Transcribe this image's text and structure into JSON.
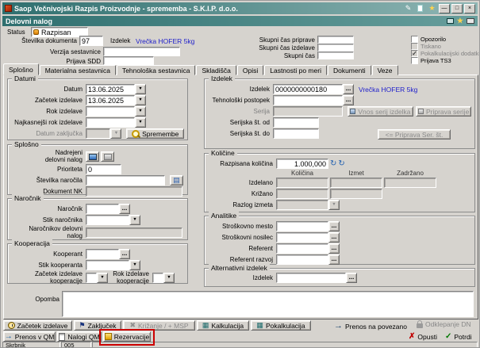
{
  "window": {
    "app_name": "Saop",
    "title": "Večnivojski Razpis Proizvodnje - sprememba  - S.K.I.P.  d.o.o.",
    "caption_bar": "Delovni nalog"
  },
  "icons": {
    "dropdown": "▼",
    "dots": "...",
    "minimize": "—",
    "maximize": "□",
    "close": "×",
    "check": "✓",
    "cross": "✗",
    "arrow_right": "→",
    "star": "★",
    "pencil": "✎",
    "flag": "⚑",
    "refresh": "↻",
    "calculator": "▦",
    "book": "▤",
    "cross_gray": "✖"
  },
  "status_row": {
    "label": "Status",
    "value": "Razpisan"
  },
  "header": {
    "doc_number": {
      "label": "Številka dokumenta",
      "value": "97"
    },
    "product": {
      "label": "Izdelek",
      "value": "Vrečka HOFER 5kg"
    },
    "bom_version_label": "Verzija sestavnice",
    "sdd_label": "Prijava SDD",
    "time_prep_label": "Skupni čas priprave",
    "time_make_label": "Skupni čas izdelave",
    "time_total_label": "Skupni čas",
    "time_prep_value": "",
    "time_make_value": "",
    "time_total_value": "",
    "checkboxes": {
      "opozorilo": "Opozorilo",
      "tiskano": "Tiskano",
      "pokalkulacijski": "Pokalkulacijski dodatki",
      "prijava_ts3": "Prijava TS3"
    }
  },
  "tabs": [
    "Splošno",
    "Materialna sestavnica",
    "Tehnološka sestavnica",
    "Skladišča",
    "Opisi",
    "Lastnosti po meri",
    "Dokumenti",
    "Veze"
  ],
  "datumi": {
    "title": "Datumi",
    "datum": {
      "label": "Datum",
      "value": "13.06.2025"
    },
    "zacetek_izdelave": {
      "label": "Začetek izdelave",
      "value": "13.06.2025"
    },
    "rok_izdelave": {
      "label": "Rok izdelave",
      "value": ""
    },
    "najkasnejsi_rok": {
      "label": "Najkasnejši rok izdelave",
      "value": ""
    },
    "datum_zakljucka": {
      "label": "Datum zaključka",
      "value": ""
    },
    "spremembe_button": "Spremembe"
  },
  "splosno": {
    "title": "Splošno",
    "nadrejeni_line1": "Nadrejeni",
    "nadrejeni_line2": "delovni nalog",
    "prioriteta": {
      "label": "Prioriteta",
      "value": "0"
    },
    "stevilka_narocila": {
      "label": "Številka naročila",
      "value": ""
    },
    "dokument_nk": {
      "label": "Dokument NK",
      "value": ""
    }
  },
  "narocnik": {
    "title": "Naročnik",
    "narocnik": {
      "label": "Naročnik",
      "value": ""
    },
    "stik_narocnika": {
      "label": "Stik naročnika",
      "value": ""
    },
    "narocnikov_dn_line1": "Naročnikov delovni",
    "narocnikov_dn_line2": "nalog",
    "narocnikov_dn_value": ""
  },
  "kooperacija": {
    "title": "Kooperacija",
    "kooperant": {
      "label": "Kooperant",
      "value": ""
    },
    "stik_kooperanta": {
      "label": "Stik kooperanta",
      "value": ""
    },
    "zacetek_line1": "Začetek izdelave",
    "zacetek_line2": "kooperacije",
    "rok_line1": "Rok izdelave",
    "rok_line2": "kooperacije"
  },
  "izdelek_group": {
    "title": "Izdelek",
    "izdelek": {
      "label": "Izdelek",
      "code": "0000000000180",
      "name": "Vrečka HOFER 5kg"
    },
    "tehnoloski_postopek": {
      "label": "Tehnološki postopek",
      "value": ""
    },
    "serija": {
      "label": "Serija",
      "value": ""
    },
    "vnos_serij_button": "Vnos serij izdelka",
    "priprava_serije_button": "Priprava serije",
    "serijska_od": {
      "label": "Serijska št. od",
      "value": ""
    },
    "serijska_do": {
      "label": "Serijska št. do",
      "value": ""
    },
    "priprava_ser_button": "<= Priprava Ser. št."
  },
  "kolicine": {
    "title": "Količine",
    "razpisana": {
      "label": "Razpisana količina",
      "value": "1.000,000"
    },
    "col_kolicina": "Količina",
    "col_izmet": "Izmet",
    "col_zadrzano": "Zadržano",
    "izdelano_label": "Izdelano",
    "krizano_label": "Križano",
    "razlog_izmeta_label": "Razlog izmeta",
    "values": {
      "izdelano": [
        "",
        "",
        ""
      ],
      "krizano": [
        "",
        ""
      ],
      "razlog": ""
    }
  },
  "analitike": {
    "title": "Analitike",
    "stroskovno_mesto": {
      "label": "Stroškovno mesto",
      "value": ""
    },
    "stroskovni_nosilec": {
      "label": "Stroškovni nosilec",
      "value": ""
    },
    "referent": {
      "label": "Referent",
      "value": ""
    },
    "referent_razvoj": {
      "label": "Referent razvoj",
      "value": ""
    }
  },
  "alternativni": {
    "title": "Alternativni izdelek",
    "izdelek": {
      "label": "Izdelek",
      "value": ""
    }
  },
  "opomba": {
    "label": "Opomba",
    "value": ""
  },
  "toolbar": {
    "zacetek_izdelave": "Začetek izdelave",
    "zakljucek": "Zaključek",
    "krizanje_msp": "Križanje / + MSP",
    "kalkulacija": "Kalkulacija",
    "pokalkulacija": "Pokalkulacija",
    "prenos_na_povezano": "Prenos na povezano",
    "odklepanje_dn": "Odklepanje DN",
    "prenos_v_qm": "Prenos v QM",
    "nalogi_qm": "Nalogi QM",
    "rezervacije": "Rezervacije",
    "opusti": "Opusti",
    "potrdi": "Potrdi"
  },
  "statusbar": {
    "user": "Skrbnik",
    "code": "005"
  },
  "colors": {
    "titlebar_teal": "#2f6f6f",
    "link_blue": "#2222cc",
    "annotation_red": "#cc0000",
    "window_face": "#d6d3ce"
  }
}
